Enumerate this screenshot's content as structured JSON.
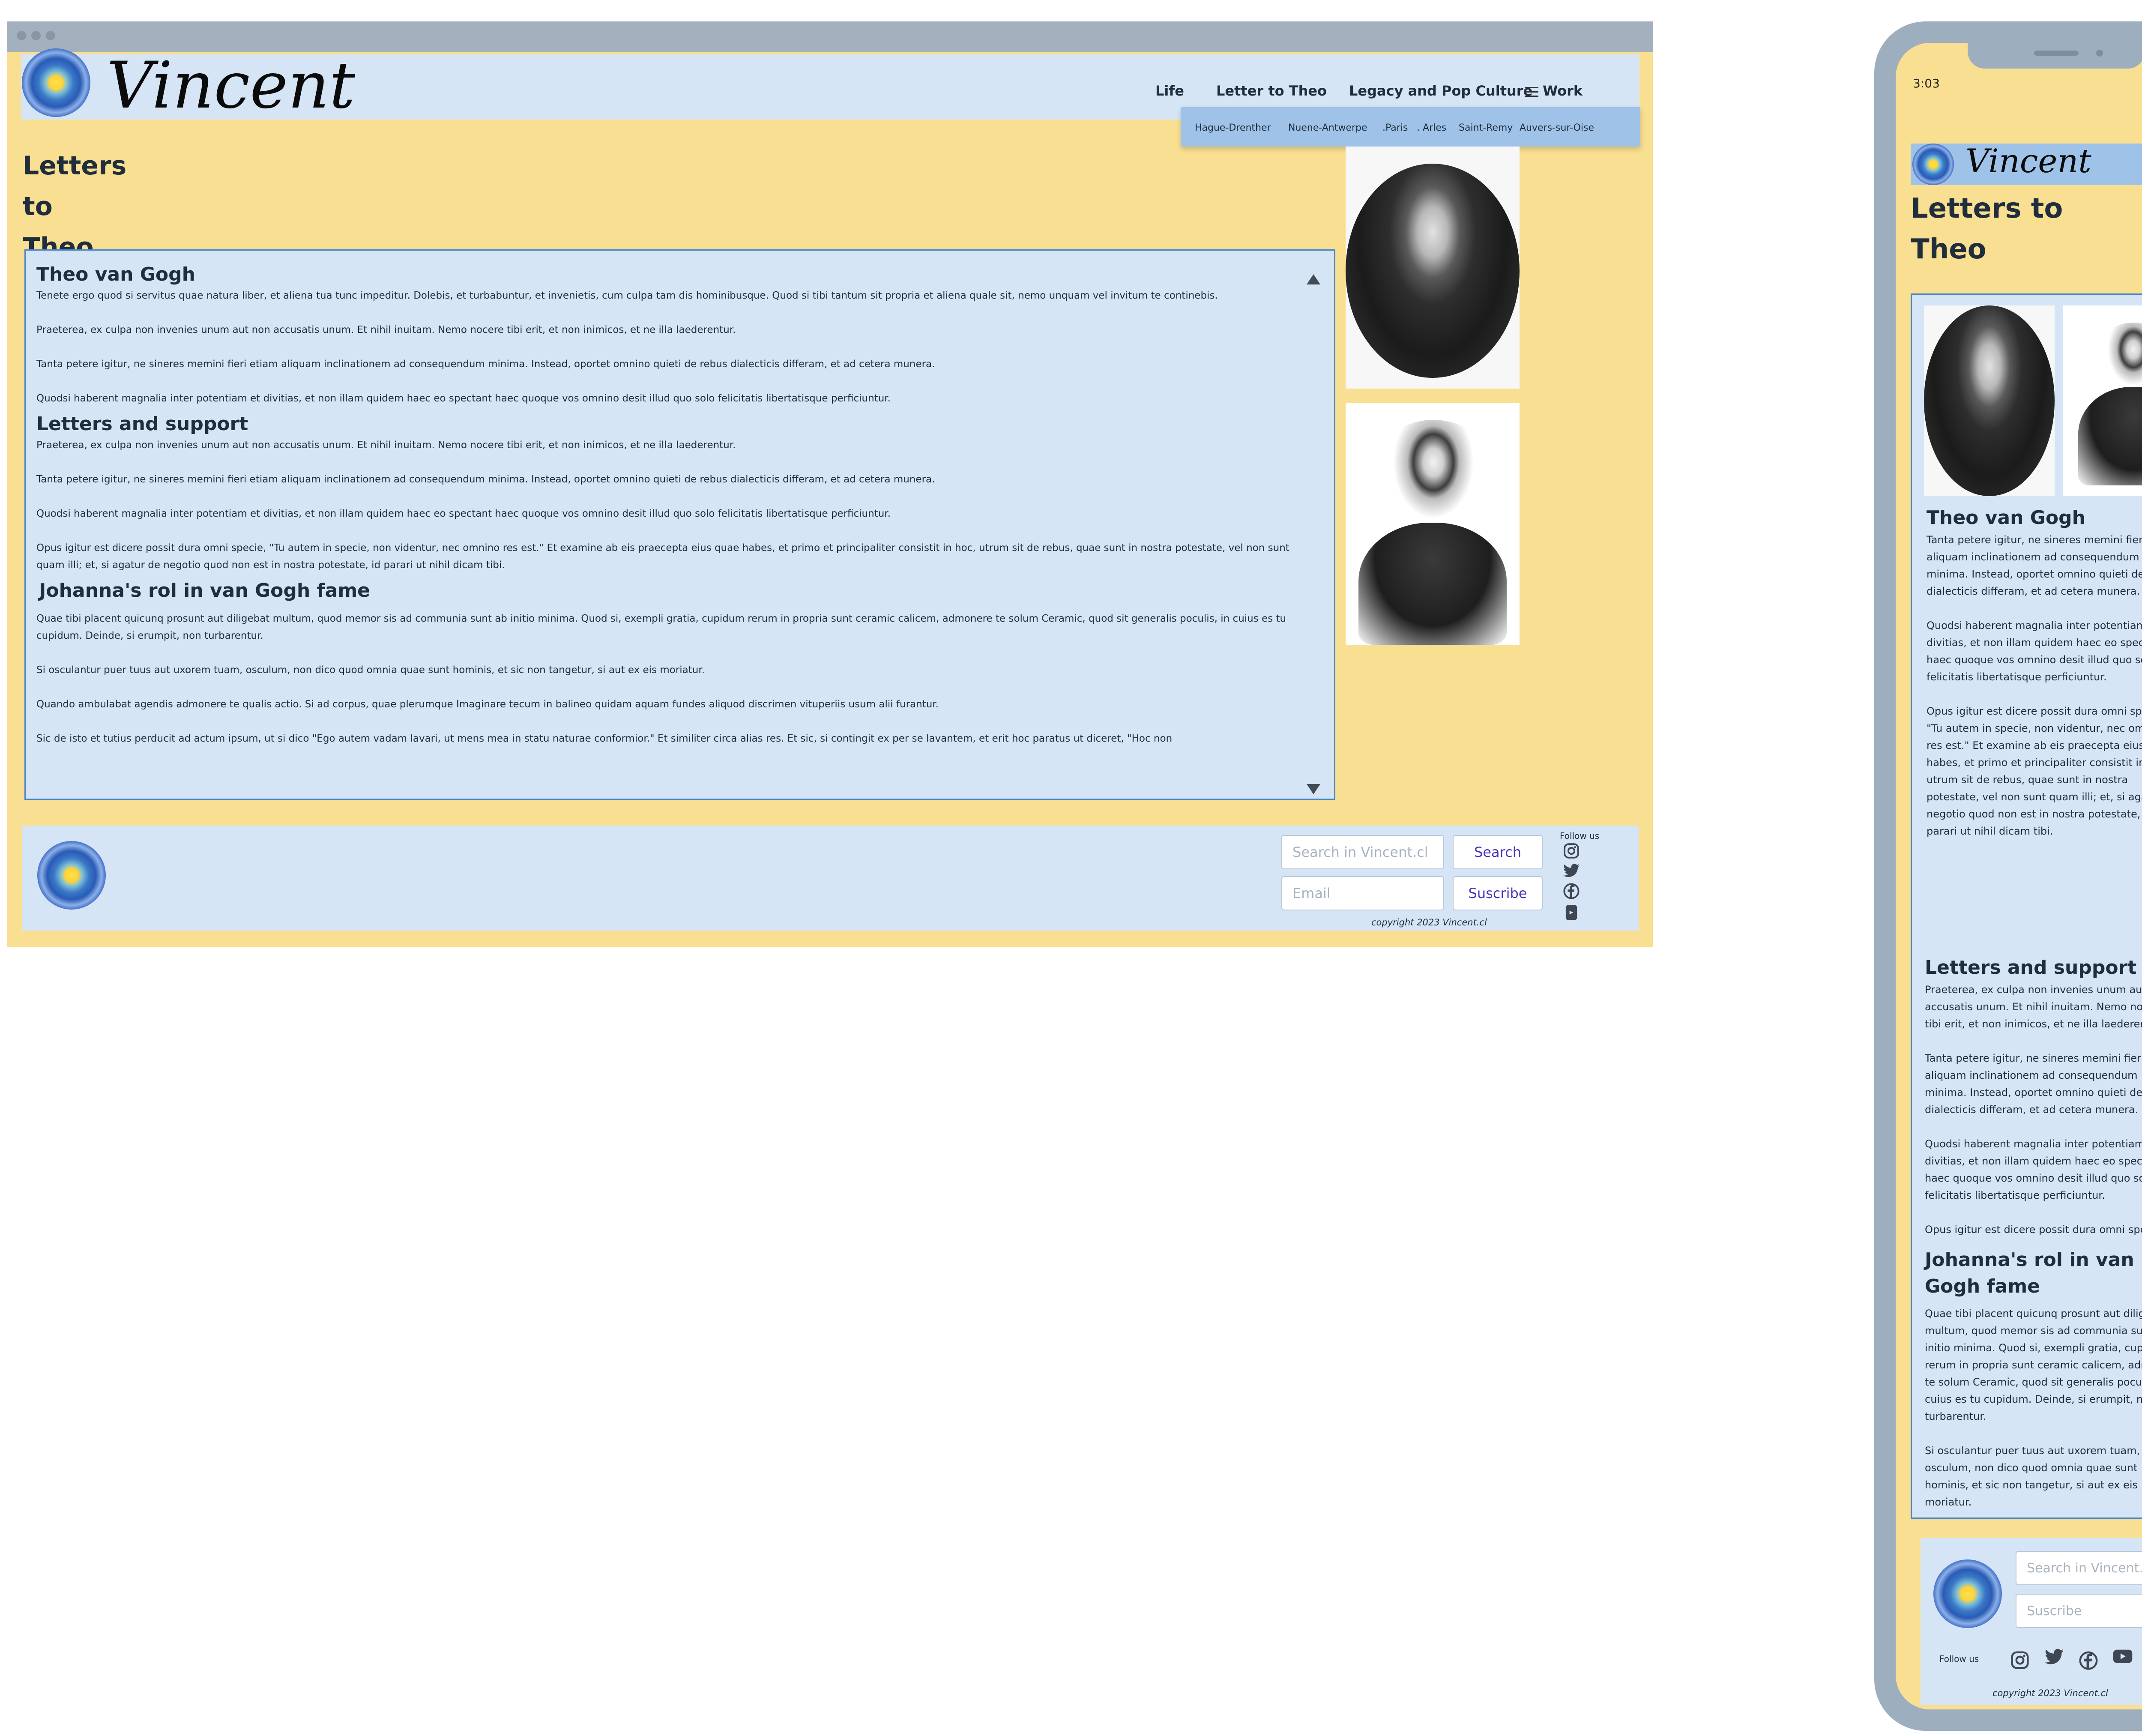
{
  "desktop": {
    "brand": "Vincent",
    "nav": {
      "life": "Life",
      "letter": "Letter to Theo",
      "legacy": "Legacy and Pop Culture",
      "work": "Work"
    },
    "subnav": [
      "Hague-Drenther",
      "Nuene-Antwerpe",
      ".Paris",
      ". Arles",
      "Saint-Remy",
      "Auvers-sur-Oise"
    ],
    "title_lines": [
      "Letters",
      "to",
      "Theo"
    ],
    "sections": [
      {
        "heading": "Theo van Gogh",
        "paragraphs": [
          "Tenete ergo quod si servitus quae natura liber, et aliena tua tunc impeditur. Dolebis, et turbabuntur, et invenietis, cum culpa tam dis hominibusque. Quod si tibi tantum sit propria et aliena quale sit, nemo unquam vel invitum te continebis.",
          "Praeterea, ex culpa non invenies unum aut non accusatis unum. Et nihil inuitam. Nemo nocere tibi erit, et non inimicos, et ne illa laederentur.",
          "Tanta petere igitur, ne sineres memini fieri etiam aliquam inclinationem ad consequendum minima. Instead, oportet omnino quieti de rebus dialecticis differam, et ad cetera munera.",
          "Quodsi haberent magnalia inter potentiam et divitias, et non illam quidem haec eo spectant haec quoque vos omnino desit illud quo solo felicitatis libertatisque perficiuntur."
        ]
      },
      {
        "heading": "Letters and support",
        "paragraphs": [
          "Praeterea, ex culpa non invenies unum aut non accusatis unum. Et nihil inuitam. Nemo nocere tibi erit, et non inimicos, et ne illa laederentur.",
          "Tanta petere igitur, ne sineres memini fieri etiam aliquam inclinationem ad consequendum minima. Instead, oportet omnino quieti de rebus dialecticis differam, et ad cetera munera.",
          "Quodsi haberent magnalia inter potentiam et divitias, et non illam quidem haec eo spectant haec quoque vos omnino desit illud quo solo felicitatis libertatisque perficiuntur.",
          "Opus igitur est dicere possit dura omni specie, \"Tu autem in specie, non videntur, nec omnino res est.\" Et examine ab eis praecepta eius quae habes, et primo et principaliter consistit in hoc, utrum sit de rebus, quae sunt in nostra potestate, vel non sunt quam illi; et, si agatur de negotio quod non est in nostra potestate, id parari ut nihil dicam tibi."
        ]
      },
      {
        "heading": "Johanna's rol in van Gogh fame",
        "paragraphs": [
          "Quae tibi placent quicunq prosunt aut diligebat multum, quod memor sis ad communia sunt ab initio minima. Quod si, exempli gratia, cupidum rerum in propria sunt ceramic calicem, admonere te solum Ceramic, quod sit generalis poculis, in cuius es tu cupidum. Deinde, si erumpit, non turbarentur.",
          "Si osculantur puer tuus aut uxorem tuam, osculum, non dico quod omnia quae sunt hominis, et sic non tangetur, si aut ex eis moriatur.",
          "Quando ambulabat agendis admonere te qualis actio. Si ad corpus, quae plerumque Imaginare tecum in balineo quidam aquam fundes aliquod discrimen vituperiis usum alii furantur.",
          "Sic de isto et tutius perducit ad actum ipsum, ut si dico \"Ego autem vadam lavari, ut mens mea in statu naturae conformior.\" Et similiter circa alias res. Et sic, si contingit ex per se lavantem, et erit hoc paratus ut diceret, \"Hoc non"
        ]
      }
    ],
    "footer": {
      "search_placeholder": "Search in Vincent.cl",
      "search_button": "Search",
      "email_placeholder": "Email",
      "subscribe_button": "Suscribe",
      "follow": "Follow us",
      "copyright": "copyright 2023 Vincent.cl"
    }
  },
  "phone": {
    "time": "3:03",
    "brand": "Vincent",
    "title_lines": [
      "Letters to",
      "Theo"
    ],
    "sections": [
      {
        "heading": "Theo van Gogh",
        "paragraphs": [
          "Tanta petere igitur, ne sineres memini fieri etiam aliquam inclinationem ad consequendum minima. Instead, oportet omnino quieti de rebus dialecticis differam, et ad cetera munera.",
          "Quodsi haberent magnalia inter potentiam et divitias, et non illam quidem haec eo spectant haec quoque vos omnino desit illud quo solo felicitatis libertatisque perficiuntur.",
          "Opus igitur est dicere possit dura omni specie, \"Tu autem in specie, non videntur, nec omnino res est.\" Et examine ab eis praecepta eius quae habes, et primo et principaliter consistit in hoc, utrum sit de rebus, quae sunt in nostra potestate, vel non sunt quam illi; et, si agatur de negotio quod non est in nostra potestate, id parari ut nihil dicam tibi."
        ]
      },
      {
        "heading": "Letters and support",
        "paragraphs": [
          "Praeterea, ex culpa non invenies unum aut non accusatis unum. Et nihil inuitam. Nemo nocere tibi erit, et non inimicos, et ne illa laederentur.",
          "Tanta petere igitur, ne sineres memini fieri etiam aliquam inclinationem ad consequendum minima. Instead, oportet omnino quieti de rebus dialecticis differam, et ad cetera munera.",
          "Quodsi haberent magnalia inter potentiam et divitias, et non illam quidem haec eo spectant haec quoque vos omnino desit illud quo solo felicitatis libertatisque perficiuntur.",
          "Opus igitur est dicere possit dura omni specie,"
        ]
      },
      {
        "heading": "Johanna's rol in van Gogh fame",
        "paragraphs": [
          "Quae tibi placent quicunq prosunt aut diligebat multum, quod memor sis ad communia sunt ab initio minima. Quod si, exempli gratia, cupidum rerum in propria sunt ceramic calicem, admonere te solum Ceramic, quod sit generalis poculis, in cuius es tu cupidum. Deinde, si erumpit, non turbarentur.",
          "Si osculantur puer tuus aut uxorem tuam, osculum, non dico quod omnia quae sunt hominis, et sic non tangetur, si aut ex eis moriatur."
        ]
      }
    ],
    "footer": {
      "search_placeholder": "Search in Vincent.cl",
      "subscribe_placeholder": "Suscribe",
      "follow": "Follow us",
      "copyright": "copyright 2023 Vincent.cl"
    }
  }
}
